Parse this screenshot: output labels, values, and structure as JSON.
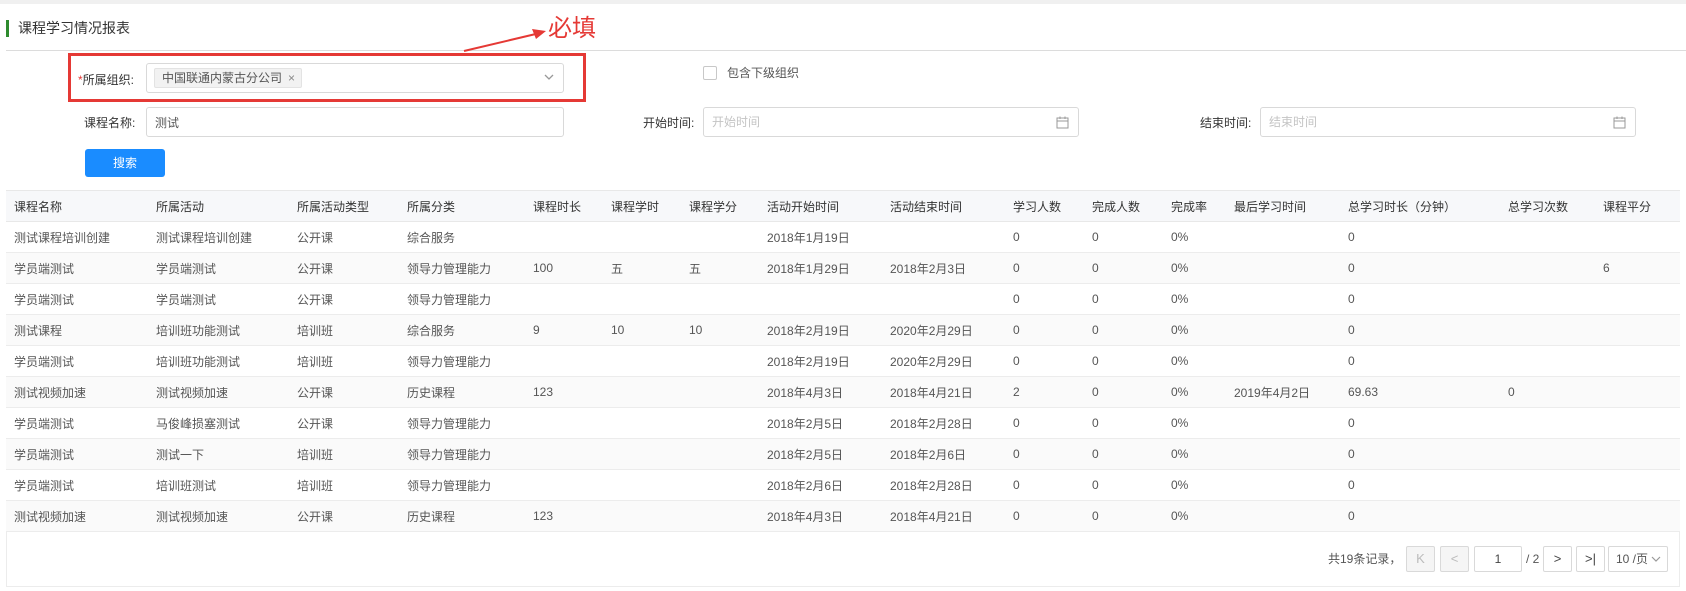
{
  "page": {
    "title": "课程学习情况报表",
    "annotation": "必填"
  },
  "filters": {
    "org_label": "*所属组织:",
    "org_required_mark": "*",
    "org_label_text": "所属组织:",
    "org_tag": "中国联通内蒙古分公司",
    "org_tag_remove": "×",
    "include_sub_label": "包含下级组织",
    "include_sub_checked": false,
    "course_name_label": "课程名称:",
    "course_name_value": "测试",
    "start_time_label": "开始时间:",
    "start_time_placeholder": "开始时间",
    "end_time_label": "结束时间:",
    "end_time_placeholder": "结束时间",
    "search_button": "搜索"
  },
  "table": {
    "columns": [
      "课程名称",
      "所属活动",
      "所属活动类型",
      "所属分类",
      "课程时长",
      "课程学时",
      "课程学分",
      "活动开始时间",
      "活动结束时间",
      "学习人数",
      "完成人数",
      "完成率",
      "最后学习时间",
      "总学习时长（分钟）",
      "总学习次数",
      "课程平分"
    ],
    "rows": [
      [
        "测试课程培训创建",
        "测试课程培训创建",
        "公开课",
        "综合服务",
        "",
        "",
        "",
        "2018年1月19日",
        "",
        "0",
        "0",
        "0%",
        "",
        "0",
        "",
        ""
      ],
      [
        "学员端测试",
        "学员端测试",
        "公开课",
        "领导力管理能力",
        "100",
        "五",
        "五",
        "2018年1月29日",
        "2018年2月3日",
        "0",
        "0",
        "0%",
        "",
        "0",
        "",
        "6"
      ],
      [
        "学员端测试",
        "学员端测试",
        "公开课",
        "领导力管理能力",
        "",
        "",
        "",
        "",
        "",
        "0",
        "0",
        "0%",
        "",
        "0",
        "",
        ""
      ],
      [
        "测试课程",
        "培训班功能测试",
        "培训班",
        "综合服务",
        "9",
        "10",
        "10",
        "2018年2月19日",
        "2020年2月29日",
        "0",
        "0",
        "0%",
        "",
        "0",
        "",
        ""
      ],
      [
        "学员端测试",
        "培训班功能测试",
        "培训班",
        "领导力管理能力",
        "",
        "",
        "",
        "2018年2月19日",
        "2020年2月29日",
        "0",
        "0",
        "0%",
        "",
        "0",
        "",
        ""
      ],
      [
        "测试视频加速",
        "测试视频加速",
        "公开课",
        "历史课程",
        "123",
        "",
        "",
        "2018年4月3日",
        "2018年4月21日",
        "2",
        "0",
        "0%",
        "2019年4月2日",
        "69.63",
        "0",
        ""
      ],
      [
        "学员端测试",
        "马俊峰损塞测试",
        "公开课",
        "领导力管理能力",
        "",
        "",
        "",
        "2018年2月5日",
        "2018年2月28日",
        "0",
        "0",
        "0%",
        "",
        "0",
        "",
        ""
      ],
      [
        "学员端测试",
        "测试一下",
        "培训班",
        "领导力管理能力",
        "",
        "",
        "",
        "2018年2月5日",
        "2018年2月6日",
        "0",
        "0",
        "0%",
        "",
        "0",
        "",
        ""
      ],
      [
        "学员端测试",
        "培训班测试",
        "培训班",
        "领导力管理能力",
        "",
        "",
        "",
        "2018年2月6日",
        "2018年2月28日",
        "0",
        "0",
        "0%",
        "",
        "0",
        "",
        ""
      ],
      [
        "测试视频加速",
        "测试视频加速",
        "公开课",
        "历史课程",
        "123",
        "",
        "",
        "2018年4月3日",
        "2018年4月21日",
        "0",
        "0",
        "0%",
        "",
        "0",
        "",
        ""
      ]
    ]
  },
  "pagination": {
    "total_text": "共19条记录，",
    "first": "K",
    "prev": "<",
    "current_page": "1",
    "total_pages": "/ 2",
    "next": ">",
    "last": ">|",
    "page_size": "10 /页"
  },
  "colors": {
    "accent": "#1a8cff",
    "title_bar": "#2e8b2e",
    "annotation": "#e53935"
  }
}
